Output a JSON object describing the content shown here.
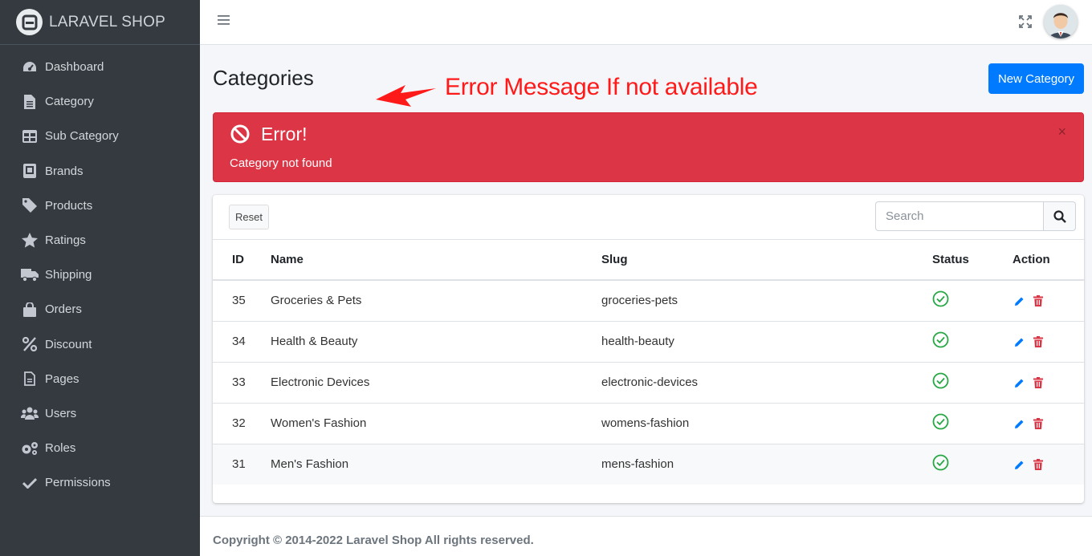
{
  "brand": {
    "name": "LARAVEL SHOP"
  },
  "sidebar": {
    "items": [
      {
        "label": "Dashboard",
        "icon": "tachometer-icon"
      },
      {
        "label": "Category",
        "icon": "file-icon"
      },
      {
        "label": "Sub Category",
        "icon": "table-icon"
      },
      {
        "label": "Brands",
        "icon": "book-icon"
      },
      {
        "label": "Products",
        "icon": "tag-icon"
      },
      {
        "label": "Ratings",
        "icon": "star-icon"
      },
      {
        "label": "Shipping",
        "icon": "truck-icon"
      },
      {
        "label": "Orders",
        "icon": "shopping-bag-icon"
      },
      {
        "label": "Discount",
        "icon": "percent-icon"
      },
      {
        "label": "Pages",
        "icon": "page-icon"
      },
      {
        "label": "Users",
        "icon": "users-icon"
      },
      {
        "label": "Roles",
        "icon": "cogs-icon"
      },
      {
        "label": "Permissions",
        "icon": "check-icon"
      }
    ]
  },
  "header": {
    "title": "Categories",
    "new_button": "New Category"
  },
  "annotation": {
    "text": "Error Message If not available",
    "color": "#ff1a1a"
  },
  "alert": {
    "title": "Error!",
    "message": "Category not found",
    "close": "×",
    "color": "#dc3545"
  },
  "toolbar": {
    "reset_label": "Reset",
    "search_placeholder": "Search"
  },
  "table": {
    "columns": [
      "ID",
      "Name",
      "Slug",
      "Status",
      "Action"
    ],
    "rows": [
      {
        "id": "35",
        "name": "Groceries & Pets",
        "slug": "groceries-pets",
        "status": "active"
      },
      {
        "id": "34",
        "name": "Health & Beauty",
        "slug": "health-beauty",
        "status": "active"
      },
      {
        "id": "33",
        "name": "Electronic Devices",
        "slug": "electronic-devices",
        "status": "active"
      },
      {
        "id": "32",
        "name": "Women's Fashion",
        "slug": "womens-fashion",
        "status": "active"
      },
      {
        "id": "31",
        "name": "Men's Fashion",
        "slug": "mens-fashion",
        "status": "active"
      }
    ]
  },
  "footer": {
    "text": "Copyright © 2014-2022 Laravel Shop All rights reserved."
  },
  "colors": {
    "sidebar": "#343a40",
    "primary": "#007bff",
    "success": "#28a745",
    "danger": "#dc3545"
  }
}
